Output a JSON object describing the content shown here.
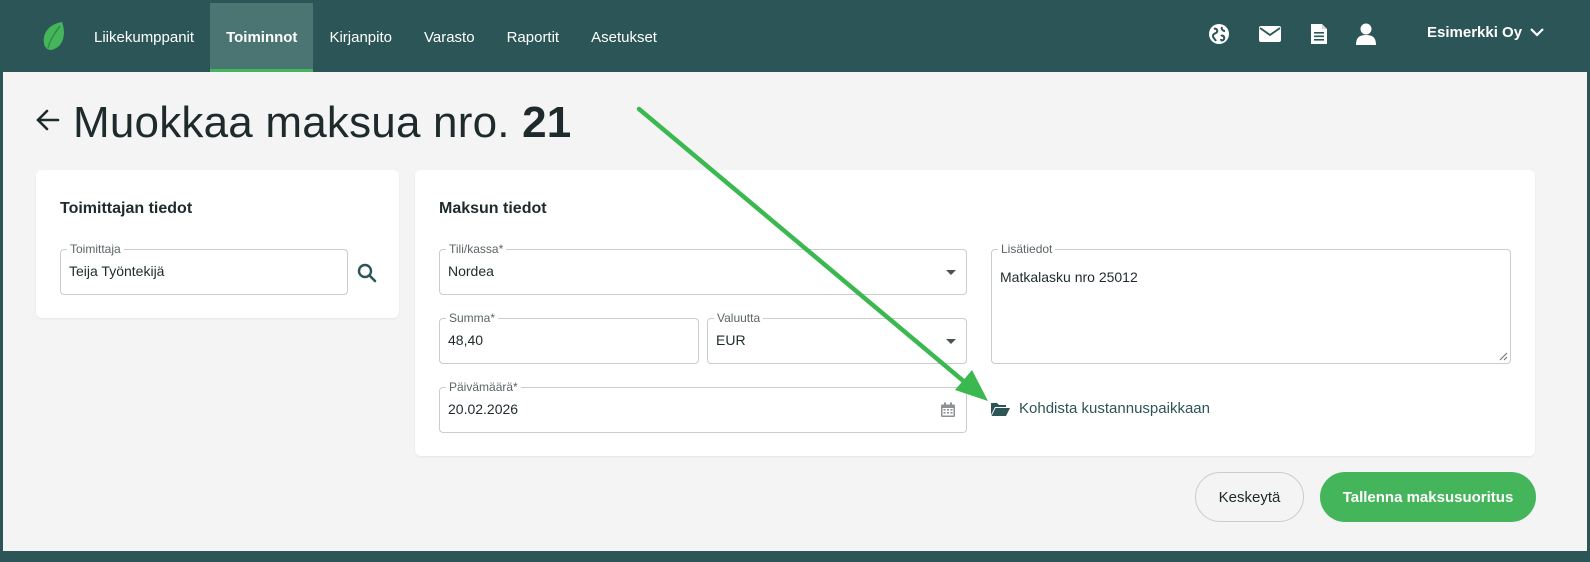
{
  "nav": {
    "items": [
      {
        "label": "Liikekumppanit"
      },
      {
        "label": "Toiminnot"
      },
      {
        "label": "Kirjanpito"
      },
      {
        "label": "Varasto"
      },
      {
        "label": "Raportit"
      },
      {
        "label": "Asetukset"
      }
    ],
    "active": "Toiminnot",
    "company": "Esimerkki Oy",
    "icons": [
      "globe-icon",
      "mail-icon",
      "document-icon",
      "user-icon",
      "chevron-down-icon"
    ]
  },
  "page": {
    "title_prefix": "Muokkaa maksua nro.",
    "title_number": "21"
  },
  "supplier": {
    "heading": "Toimittajan tiedot",
    "label": "Toimittaja",
    "value": "Teija Työntekijä"
  },
  "payment": {
    "heading": "Maksun tiedot",
    "account_label": "Tili/kassa",
    "account_value": "Nordea",
    "amount_label": "Summa",
    "amount_value": "48,40",
    "currency_label": "Valuutta",
    "currency_value": "EUR",
    "date_label": "Päivämäärä",
    "date_value": "20.02.2026",
    "notes_label": "Lisätiedot",
    "notes_value": "Matkalasku nro 25012",
    "cost_center_link": "Kohdista kustannuspaikkaan",
    "required_mark": "*"
  },
  "actions": {
    "cancel": "Keskeytä",
    "save": "Tallenna maksusuoritus"
  },
  "colors": {
    "header": "#2c5557",
    "active_tab": "#4a7573",
    "accent": "#44b55b",
    "background": "#f3f4f3"
  }
}
